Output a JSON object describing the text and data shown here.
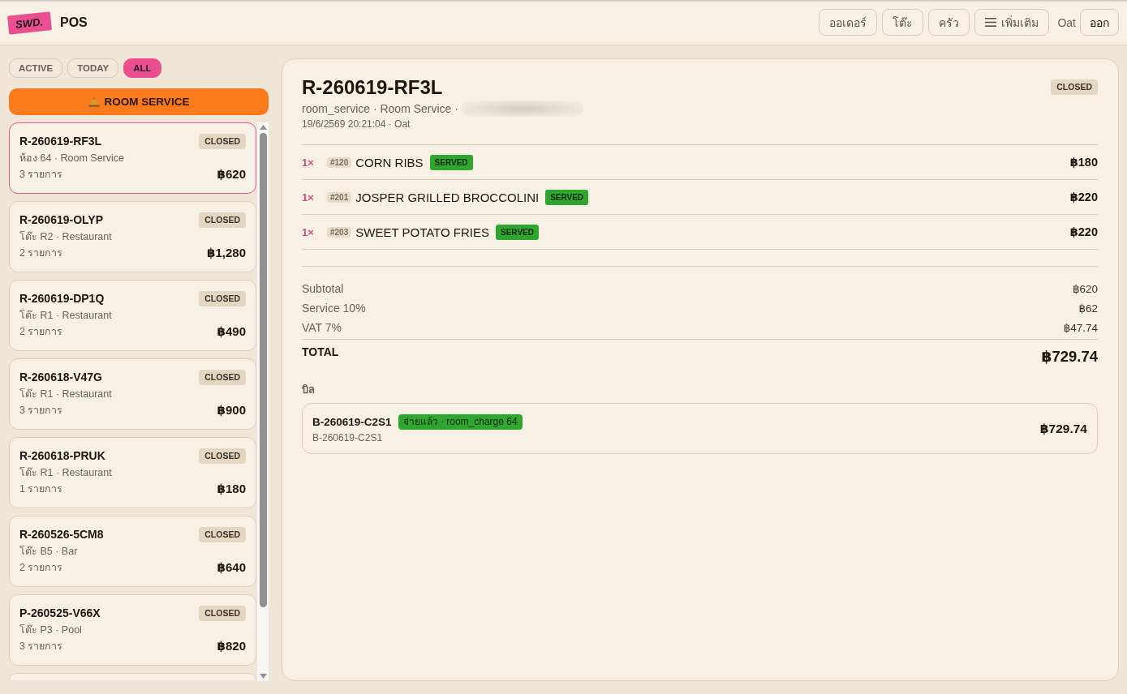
{
  "header": {
    "logo": "SWD.",
    "title": "POS",
    "nav_buttons": [
      {
        "label": "ออเดอร์",
        "kind": "plain"
      },
      {
        "label": "โต๊ะ",
        "kind": "plain"
      },
      {
        "label": "ครัว",
        "kind": "plain"
      },
      {
        "label": "เพิ่มเติม",
        "kind": "menu"
      }
    ],
    "user_name": "Oat",
    "logout_button": "ออก"
  },
  "filters": [
    {
      "label": "ACTIVE",
      "selected": false
    },
    {
      "label": "TODAY",
      "selected": false
    },
    {
      "label": "ALL",
      "selected": true
    }
  ],
  "room_service_button": {
    "label": "ROOM SERVICE"
  },
  "orders": [
    {
      "id": "R-260619-RF3L",
      "status": "CLOSED",
      "location": "ห้อง 64 · Room Service",
      "item_count": "3 รายการ",
      "total": "฿620",
      "selected": true
    },
    {
      "id": "R-260619-OLYP",
      "status": "CLOSED",
      "location": "โต๊ะ R2 · Restaurant",
      "item_count": "2 รายการ",
      "total": "฿1,280",
      "selected": false
    },
    {
      "id": "R-260619-DP1Q",
      "status": "CLOSED",
      "location": "โต๊ะ R1 · Restaurant",
      "item_count": "2 รายการ",
      "total": "฿490",
      "selected": false
    },
    {
      "id": "R-260618-V47G",
      "status": "CLOSED",
      "location": "โต๊ะ R1 · Restaurant",
      "item_count": "3 รายการ",
      "total": "฿900",
      "selected": false
    },
    {
      "id": "R-260618-PRUK",
      "status": "CLOSED",
      "location": "โต๊ะ R1 · Restaurant",
      "item_count": "1 รายการ",
      "total": "฿180",
      "selected": false
    },
    {
      "id": "R-260526-5CM8",
      "status": "CLOSED",
      "location": "โต๊ะ B5 · Bar",
      "item_count": "2 รายการ",
      "total": "฿640",
      "selected": false
    },
    {
      "id": "P-260525-V66X",
      "status": "CLOSED",
      "location": "โต๊ะ P3 · Pool",
      "item_count": "3 รายการ",
      "total": "฿820",
      "selected": false
    }
  ],
  "detail": {
    "title": "R-260619-RF3L",
    "status": "CLOSED",
    "subtitle": "room_service · Room Service ·",
    "timestamp": "19/6/2569 20:21:04 · Oat",
    "items": [
      {
        "qty": "1×",
        "code": "#120",
        "name": "CORN RIBS",
        "status": "SERVED",
        "price": "฿180"
      },
      {
        "qty": "1×",
        "code": "#201",
        "name": "JOSPER GRILLED BROCCOLINI",
        "status": "SERVED",
        "price": "฿220"
      },
      {
        "qty": "1×",
        "code": "#203",
        "name": "SWEET POTATO FRIES",
        "status": "SERVED",
        "price": "฿220"
      }
    ],
    "totals": [
      {
        "label": "Subtotal",
        "value": "฿620",
        "kind": "line"
      },
      {
        "label": "Service 10%",
        "value": "฿62",
        "kind": "line"
      },
      {
        "label": "VAT 7%",
        "value": "฿47.74",
        "kind": "line"
      },
      {
        "label": "TOTAL",
        "value": "฿729.74",
        "kind": "grand"
      }
    ],
    "bills_label": "บิล",
    "bills": [
      {
        "id": "B-260619-C2S1",
        "status": "จ่ายแล้ว · room_charge 64",
        "reference": "B-260619-C2S1",
        "total": "฿729.74"
      }
    ]
  }
}
